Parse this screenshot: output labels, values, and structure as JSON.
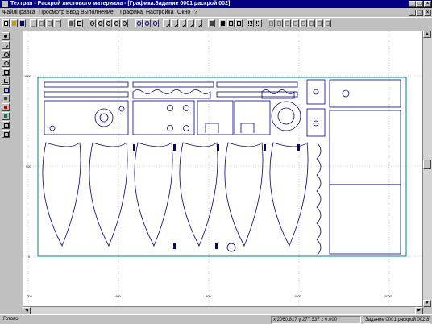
{
  "window": {
    "title": "Техтран - Раскрой листового материала - [Графика.Задание 0001 раскрой 002]",
    "controls": [
      "minimize",
      "maximize",
      "close"
    ]
  },
  "menu": {
    "items": [
      "Файл",
      "Правка",
      "Просмотр",
      "Ввод",
      "Выполнение",
      "Графика",
      "Настройка",
      "Окно",
      "?"
    ]
  },
  "toolbar": {
    "icons": [
      "new-icon",
      "open-icon",
      "save-icon",
      "cut-icon",
      "copy-icon",
      "paste-icon",
      "undo-icon",
      "print-icon",
      "preview-icon",
      "zoom-window-icon",
      "zoom-in-icon",
      "zoom-out-icon",
      "zoom-all-icon",
      "zoom-prev-icon",
      "zoom-fit-icon",
      "pan-icon",
      "line-icon",
      "arc-icon",
      "measure-icon",
      "select-icon",
      "rotate-icon",
      "move-icon",
      "mirror-icon",
      "copy-part-icon",
      "array-icon",
      "grid-icon",
      "snap-icon",
      "layer-icon",
      "properties-icon"
    ]
  },
  "left_toolbar": {
    "icons": [
      "point-icon",
      "line-icon",
      "circle-icon",
      "arc-icon",
      "rect-icon",
      "polyline-icon",
      "contour-icon",
      "text-icon",
      "hatch-icon",
      "dimension-icon",
      "cut-icon",
      "color-icon",
      "part-icon",
      "sheet-icon",
      "tool-icon"
    ]
  },
  "canvas": {
    "y_ticks": [
      "1000",
      "500",
      "0"
    ],
    "x_ticks": [
      "-200",
      "400",
      "800",
      "1500",
      "2000"
    ]
  },
  "statusbar": {
    "ready": "Готово",
    "coords": "x 2060.817 y 277.537 z 0.000",
    "job": "Задание 0001 раскрой 002.87"
  },
  "colors": {
    "titlebar": "#000080",
    "part_outline": "#000080",
    "sheet_outline": "#008080",
    "grid": "#808080"
  }
}
